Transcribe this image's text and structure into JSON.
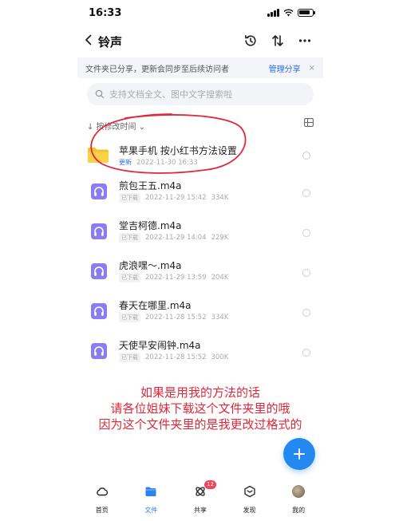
{
  "status_bar": {
    "time": "16:33"
  },
  "nav": {
    "title": "铃声"
  },
  "share_banner": {
    "text": "文件夹已分享，更新会同步至后续访问者",
    "manage_label": "管理分享",
    "close_label": "×"
  },
  "search": {
    "placeholder": "支持文档全文、图中文字搜索啦"
  },
  "sort": {
    "label": "↓ 按修改时间 ⌄"
  },
  "files": [
    {
      "name": "苹果手机 按小红书方法设置",
      "badge": "更新",
      "date": "2022-11-30 16:33",
      "size": "",
      "type": "folder"
    },
    {
      "name": "煎包王五.m4a",
      "badge": "已下载",
      "date": "2022-11-29 15:42",
      "size": "334K",
      "type": "audio"
    },
    {
      "name": "堂吉柯德.m4a",
      "badge": "已下载",
      "date": "2022-11-29 14:04",
      "size": "229K",
      "type": "audio"
    },
    {
      "name": "虎浪嘿～.m4a",
      "badge": "已下载",
      "date": "2022-11-29 13:59",
      "size": "204K",
      "type": "audio"
    },
    {
      "name": "春天在哪里.m4a",
      "badge": "已下载",
      "date": "2022-11-28 15:52",
      "size": "334K",
      "type": "audio"
    },
    {
      "name": "天使早安闹钟.m4a",
      "badge": "已下载",
      "date": "2022-11-28 15:52",
      "size": "300K",
      "type": "audio"
    }
  ],
  "caption": {
    "line1": "如果是用我的方法的话",
    "line2": "请各位姐妹下载这个文件夹里的哦",
    "line3": "因为这个文件夹里的是我更改过格式的"
  },
  "tabs": [
    {
      "label": "首页",
      "icon": "cloud-icon"
    },
    {
      "label": "文件",
      "icon": "folder-icon",
      "active": true
    },
    {
      "label": "共享",
      "icon": "share-orbit-icon",
      "badge": "12"
    },
    {
      "label": "发现",
      "icon": "discover-cube-icon"
    },
    {
      "label": "我的",
      "icon": "avatar"
    }
  ],
  "colors": {
    "accent": "#2389f1",
    "link": "#2a6df4",
    "annotation": "#e0283a",
    "folder": "#f7c12e",
    "audio_icon": "#8a7df0",
    "badge": "#f2455b"
  }
}
